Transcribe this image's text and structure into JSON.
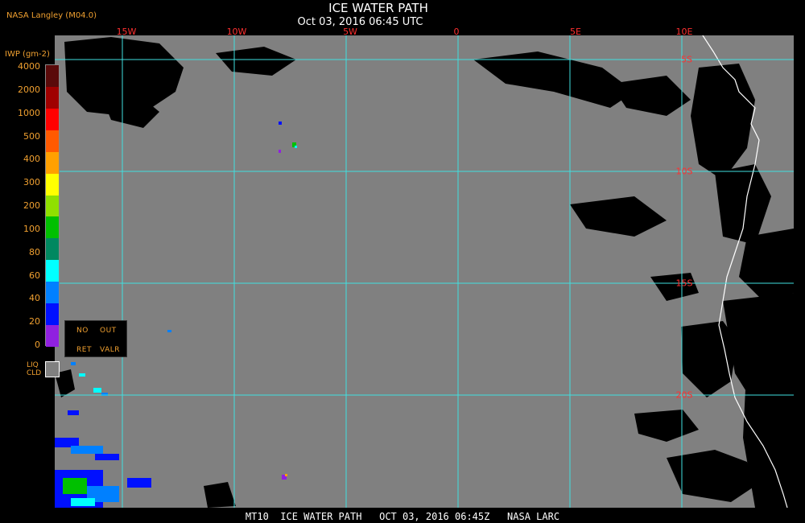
{
  "header": {
    "title": "ICE WATER PATH",
    "timestamp": "Oct 03, 2016 06:45 UTC",
    "producer": "NASA Langley (M04.0)"
  },
  "map": {
    "background_color": "#808080",
    "grid_color": "#40e0e0",
    "label_color": "#ff3030",
    "longitude_labels": [
      "15W",
      "10W",
      "5W",
      "0",
      "5E",
      "10E"
    ],
    "latitude_labels": [
      "5S",
      "10S",
      "15S",
      "20S"
    ]
  },
  "legend": {
    "title": "IWP (gm-2)",
    "ticks": [
      "4000",
      "2000",
      "1000",
      "500",
      "400",
      "300",
      "200",
      "100",
      "80",
      "60",
      "40",
      "20",
      "0"
    ],
    "colors": [
      "#5a0a0a",
      "#a00000",
      "#ff0000",
      "#ff5a00",
      "#ffa000",
      "#ffff00",
      "#90e000",
      "#00c000",
      "#008860",
      "#00ffff",
      "#0080ff",
      "#0010ff",
      "#9020e0"
    ],
    "no_retrieval_labels": [
      "NO",
      "OUT",
      "RET",
      "VALR"
    ],
    "liquid_cloud_label": [
      "LIQ",
      "CLD"
    ]
  },
  "footer": {
    "text": "MT10  ICE WATER PATH   OCT 03, 2016 06:45Z   NASA LARC"
  }
}
